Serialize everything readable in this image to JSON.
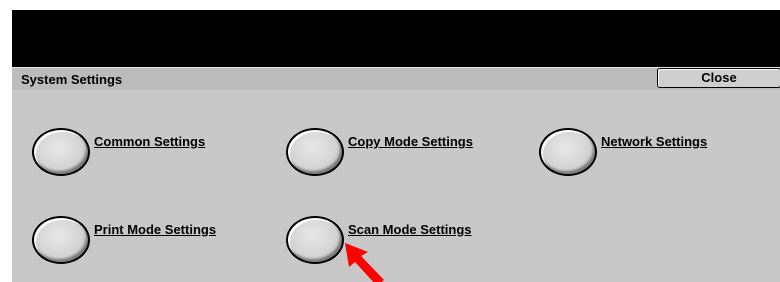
{
  "window": {
    "title": "System Settings",
    "close_label": "Close"
  },
  "options": [
    {
      "label": "Common Settings"
    },
    {
      "label": "Copy Mode Settings"
    },
    {
      "label": "Network Settings"
    },
    {
      "label": "Print Mode Settings"
    },
    {
      "label": "Scan Mode Settings"
    }
  ],
  "colors": {
    "header": "#000000",
    "panel": "#c8c8c8",
    "arrow": "#ff0000"
  },
  "icons": {
    "pointer": "red-arrow-icon"
  }
}
